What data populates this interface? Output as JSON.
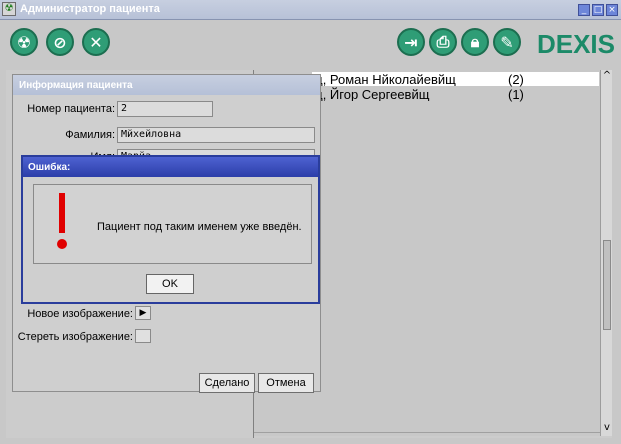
{
  "window": {
    "title": "Администратор пациента"
  },
  "toolbar": {
    "logo": "DEXIS"
  },
  "patients": [
    {
      "name": "щ, Роман Нйколайевйщ",
      "count": "(2)",
      "selected": true
    },
    {
      "name": "щ, Йгор Сергеевйщ",
      "count": "(1)",
      "selected": false
    }
  ],
  "patient_info": {
    "title": "Информация пациента",
    "number_label": "Номер пациента:",
    "number_value": "2",
    "surname_label": "Фамилия:",
    "surname_value": "Мйхейловна",
    "name_label": "Имя:",
    "name_value": "Марйа",
    "new_image_label": "Новое изображение:",
    "delete_image_label": "Стереть изображение:",
    "done_button": "Сделано",
    "cancel_button": "Отмена"
  },
  "error_dialog": {
    "title": "Ошибка:",
    "message": "Пациент под таким именем уже введён.",
    "ok_button": "OK"
  }
}
